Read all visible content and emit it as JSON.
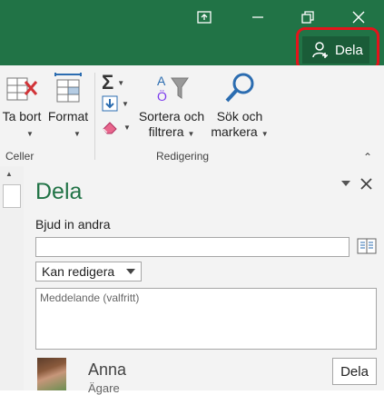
{
  "titlebar": {
    "share_label": "Dela",
    "accent": "#217346",
    "highlight_color": "#e3141b",
    "icons": [
      "restore-ribbon-icon",
      "maximize-icon",
      "close-icon",
      "share-person-icon"
    ]
  },
  "ribbon": {
    "cells": {
      "delete_label": "Ta bort",
      "format_label": "Format",
      "group_label": "Celler"
    },
    "editing": {
      "sort_label_line1": "Sortera och",
      "sort_label_line2": "filtrera",
      "find_label_line1": "Sök och",
      "find_label_line2": "markera",
      "group_label": "Redigering"
    }
  },
  "share_pane": {
    "title": "Dela",
    "invite_label": "Bjud in andra",
    "invite_value": "",
    "permission_value": "Kan redigera",
    "message_placeholder": "Meddelande (valfritt)",
    "user": {
      "name": "Anna",
      "role": "Ägare"
    },
    "share_button_label": "Dela"
  }
}
